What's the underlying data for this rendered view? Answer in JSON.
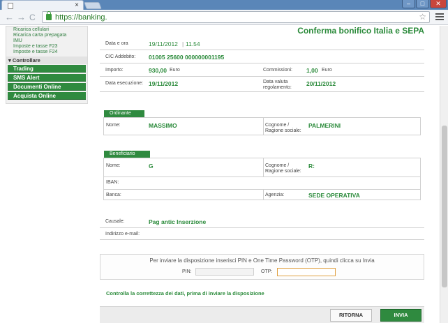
{
  "browser": {
    "tab_title": "",
    "close_tab_glyph": "×",
    "url": "https://banking.",
    "minimize_glyph": "–",
    "maximize_glyph": "□",
    "close_glyph": "✕",
    "back_glyph": "←",
    "forward_glyph": "→",
    "reload_glyph": "C",
    "star_glyph": "☆"
  },
  "sidebar": {
    "links": [
      "Ricarica cellulari",
      "Ricarica carta prepagata",
      "IMU",
      "Imposte e tasse F23",
      "Imposte e tasse F24"
    ],
    "section_label": "▾ Controllare",
    "buttons": [
      "Trading",
      "SMS Alert",
      "Documenti Online",
      "Acquista Online"
    ]
  },
  "page": {
    "title": "Conferma bonifico Italia e SEPA",
    "date_label": "Data e ora",
    "date_value": "19/11/2012",
    "time_value": "11.54",
    "account_label": "C/C Addebito:",
    "account_value": "01005 25600 000000001195",
    "amount_label": "Importo:",
    "amount_value": "930,00",
    "amount_unit": "Euro",
    "commission_label": "Commissioni:",
    "commission_value": "1,00",
    "commission_unit": "Euro",
    "exec_label": "Data esecuzione:",
    "exec_value": "19/11/2012",
    "valuta_label_1": "Data valuta",
    "valuta_label_2": "regolamento:",
    "valuta_value": "20/11/2012"
  },
  "ordinante": {
    "tag": "Ordinante",
    "name_label": "Nome:",
    "name_value": "MASSIMO",
    "surname_label_1": "Cognome /",
    "surname_label_2": "Ragione sociale:",
    "surname_value": "PALMERINI"
  },
  "beneficiario": {
    "tag": "Beneficiario",
    "name_label": "Nome:",
    "name_value": "G",
    "surname_label_1": "Cognome /",
    "surname_label_2": "Ragione sociale:",
    "surname_value": "R:",
    "iban_label": "IBAN:",
    "iban_value": "",
    "bank_label": "Banca:",
    "agency_label": "Agenzia:",
    "agency_value": "SEDE OPERATIVA"
  },
  "causale": {
    "label": "Causale:",
    "value": "Pag antic Inserzione",
    "email_label": "Indirizzo e-mail:"
  },
  "otp": {
    "instruction": "Per inviare la disposizione inserisci PIN e One Time Password (OTP), quindi clicca su Invia",
    "pin_label": "PIN:",
    "otp_label": "OTP:"
  },
  "footer": {
    "warning": "Controlla la correttezza dei dati, prima di inviare la disposizione",
    "back_button": "RITORNA",
    "send_button": "INVIA"
  },
  "colors": {
    "brand_green": "#2f8a3f",
    "text_green": "#2a8a3a",
    "window_blue": "#5a86b8"
  },
  "icons": [
    "page-icon",
    "lock-icon",
    "star-icon",
    "menu-icon"
  ]
}
